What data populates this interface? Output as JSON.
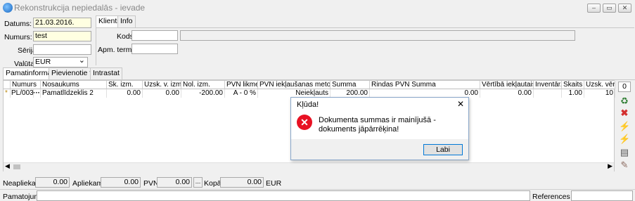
{
  "window": {
    "title": "Rekonstrukcija nepiedalās - ievade",
    "minimize_glyph": "‒",
    "restore_glyph": "▭",
    "close_glyph": "✕"
  },
  "header": {
    "datums_label": "Datums:",
    "datums_value": "21.03.2016.",
    "numurs_label": "Numurs:",
    "numurs_value": "test",
    "serija_label": "Sērija:",
    "serija_value": "",
    "valuta_label": "Valūta:",
    "valuta_value": "EUR",
    "dropdown_glyph": "⌄"
  },
  "client_tabs": {
    "tabs": [
      "Klients",
      "Info"
    ],
    "kods_label": "Kods:",
    "kods_value": "",
    "apm_label": "Apm. termiņš:",
    "apm_value": ""
  },
  "main_tabs": [
    "Pamatinformācija",
    "Pievienotie faili",
    "Intrastat"
  ],
  "grid": {
    "columns": [
      "Numurs",
      "Nosaukums",
      "Sk. izm.",
      "Uzsk. v. izm.",
      "Nol. izm.",
      "PVN likme",
      "PVN iekļaušanas metode",
      "Summa",
      "Rindas PVN Summa",
      "Vērtībā iekļautais P...",
      "Inventār...",
      "Skaits",
      "Uzsk. vērt..."
    ],
    "row": {
      "marker": "*",
      "numurs": "PL/0032",
      "ellipsis": "···",
      "nosaukums": "Pamatlīdzeklis 2",
      "sk_izm": "0.00",
      "uzsk_v_izm": "0.00",
      "nol_izm": "-200.00",
      "pvn_likme": "A - 0 %",
      "pvn_metode": "Neiekļauts",
      "summa": "200.00",
      "rindas_pvn": "0.00",
      "vertiba_p": "0.00",
      "inventar": "",
      "skaits": "1.00",
      "uzsk_vert": "10"
    }
  },
  "side_panel": {
    "count": "0"
  },
  "totals": {
    "neapliekama_label": "Neapliekamā:",
    "neapliekama_value": "0.00",
    "apliekama_label": "Apliekamā:",
    "apliekama_value": "0.00",
    "pvn_label": "PVN:",
    "pvn_value": "0.00",
    "pvn_button": "...",
    "kopa_label": "Kopā:",
    "kopa_value": "0.00",
    "currency": "EUR"
  },
  "bottom": {
    "pamatojums_label": "Pamatojums:",
    "pamatojums_value": "",
    "references_label": "References Nr.:",
    "references_value": ""
  },
  "dialog": {
    "title": "Kļūda!",
    "message": "Dokumenta summas ir mainījušā - dokuments jāpārrēķina!",
    "ok_label": "Labi",
    "close_glyph": "✕"
  },
  "colors": {
    "error_red": "#e81123",
    "dialog_border": "#8aa7c9",
    "accent_blue": "#0078d7",
    "input_yellow": "#ffffe1"
  }
}
